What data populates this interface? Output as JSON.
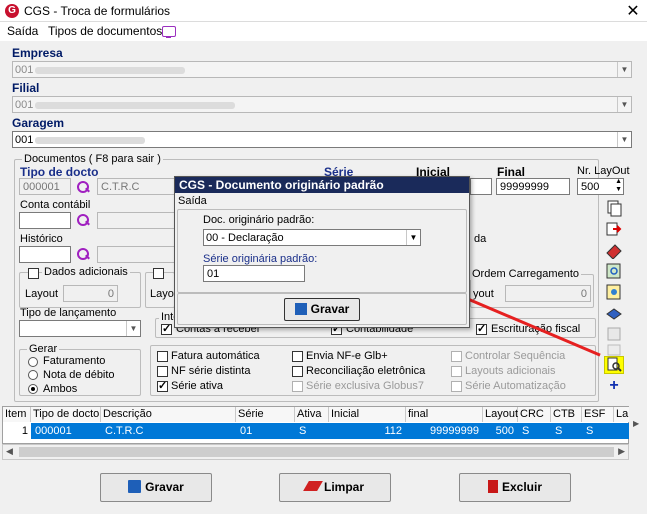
{
  "window": {
    "title": "CGS - Troca de formulários",
    "close": "✕"
  },
  "menu": {
    "items": [
      "Saída",
      "Tipos de documentos"
    ]
  },
  "empresa": {
    "label": "Empresa",
    "value": "001"
  },
  "filial": {
    "label": "Filial",
    "value": "001"
  },
  "garagem": {
    "label": "Garagem",
    "value": "001"
  },
  "documentos": {
    "legend": "Documentos ( F8 para sair )",
    "tipo_docto_label": "Tipo de docto",
    "tipo_docto_code": "000001",
    "tipo_docto_desc": "C.T.R.C",
    "serie_label": "Série",
    "inicial_label": "Inicial",
    "final_label": "Final",
    "final_value": "99999999",
    "nr_layout_label": "Nr. LayOut",
    "nr_layout_value": "500",
    "conta_contabil_label": "Conta contábil",
    "historico_label": "Histórico",
    "historico_right": "da",
    "dados_adicionais": "Dados adicionais",
    "layout_label": "Layout",
    "layout_value": "0",
    "layout2_label": "Layo",
    "ordem_label": "Ordem Carregamento",
    "layout3_label": "yout",
    "layout3_value": "0",
    "tipo_lancamento_label": "Tipo de lançamento",
    "int_label": "Inte",
    "contas_receber": "Contas a receber",
    "contabilidade": "Contabilidade",
    "escrituracao": "Escrituração fiscal",
    "gerar_legend": "Gerar",
    "gerar_options": [
      "Faturamento",
      "Nota de débito",
      "Ambos"
    ],
    "checks_col1": [
      "Fatura automática",
      "NF série distinta",
      "Série ativa"
    ],
    "checks_col2": [
      "Envia NF-e Glb+",
      "Reconciliação eletrônica",
      "Série exclusiva Globus7"
    ],
    "checks_col3": [
      "Controlar Sequência",
      "Layouts adicionais",
      "Série Automatização"
    ]
  },
  "grid": {
    "headers": [
      "Item",
      "Tipo de docto",
      "Descrição",
      "Série",
      "Ativa",
      "Inicial",
      "final",
      "Layout",
      "CRC",
      "CTB",
      "ESF",
      "La"
    ],
    "row": [
      "1",
      "000001",
      "C.T.R.C",
      "01",
      "S",
      "112",
      "99999999",
      "500",
      "S",
      "S",
      "S"
    ]
  },
  "buttons": {
    "gravar": "Gravar",
    "limpar": "Limpar",
    "excluir": "Excluir"
  },
  "dialog": {
    "title": "CGS - Documento originário padrão",
    "menu": "Saída",
    "doc_label": "Doc. originário padrão:",
    "doc_value": "00 - Declaração",
    "serie_label": "Série originária padrão:",
    "serie_value": "01",
    "gravar": "Gravar"
  },
  "colors": {
    "dialog_title": "#1a2a5a",
    "selection": "#0078d7",
    "arrow": "#e62020",
    "highlight": "#ffff00"
  }
}
